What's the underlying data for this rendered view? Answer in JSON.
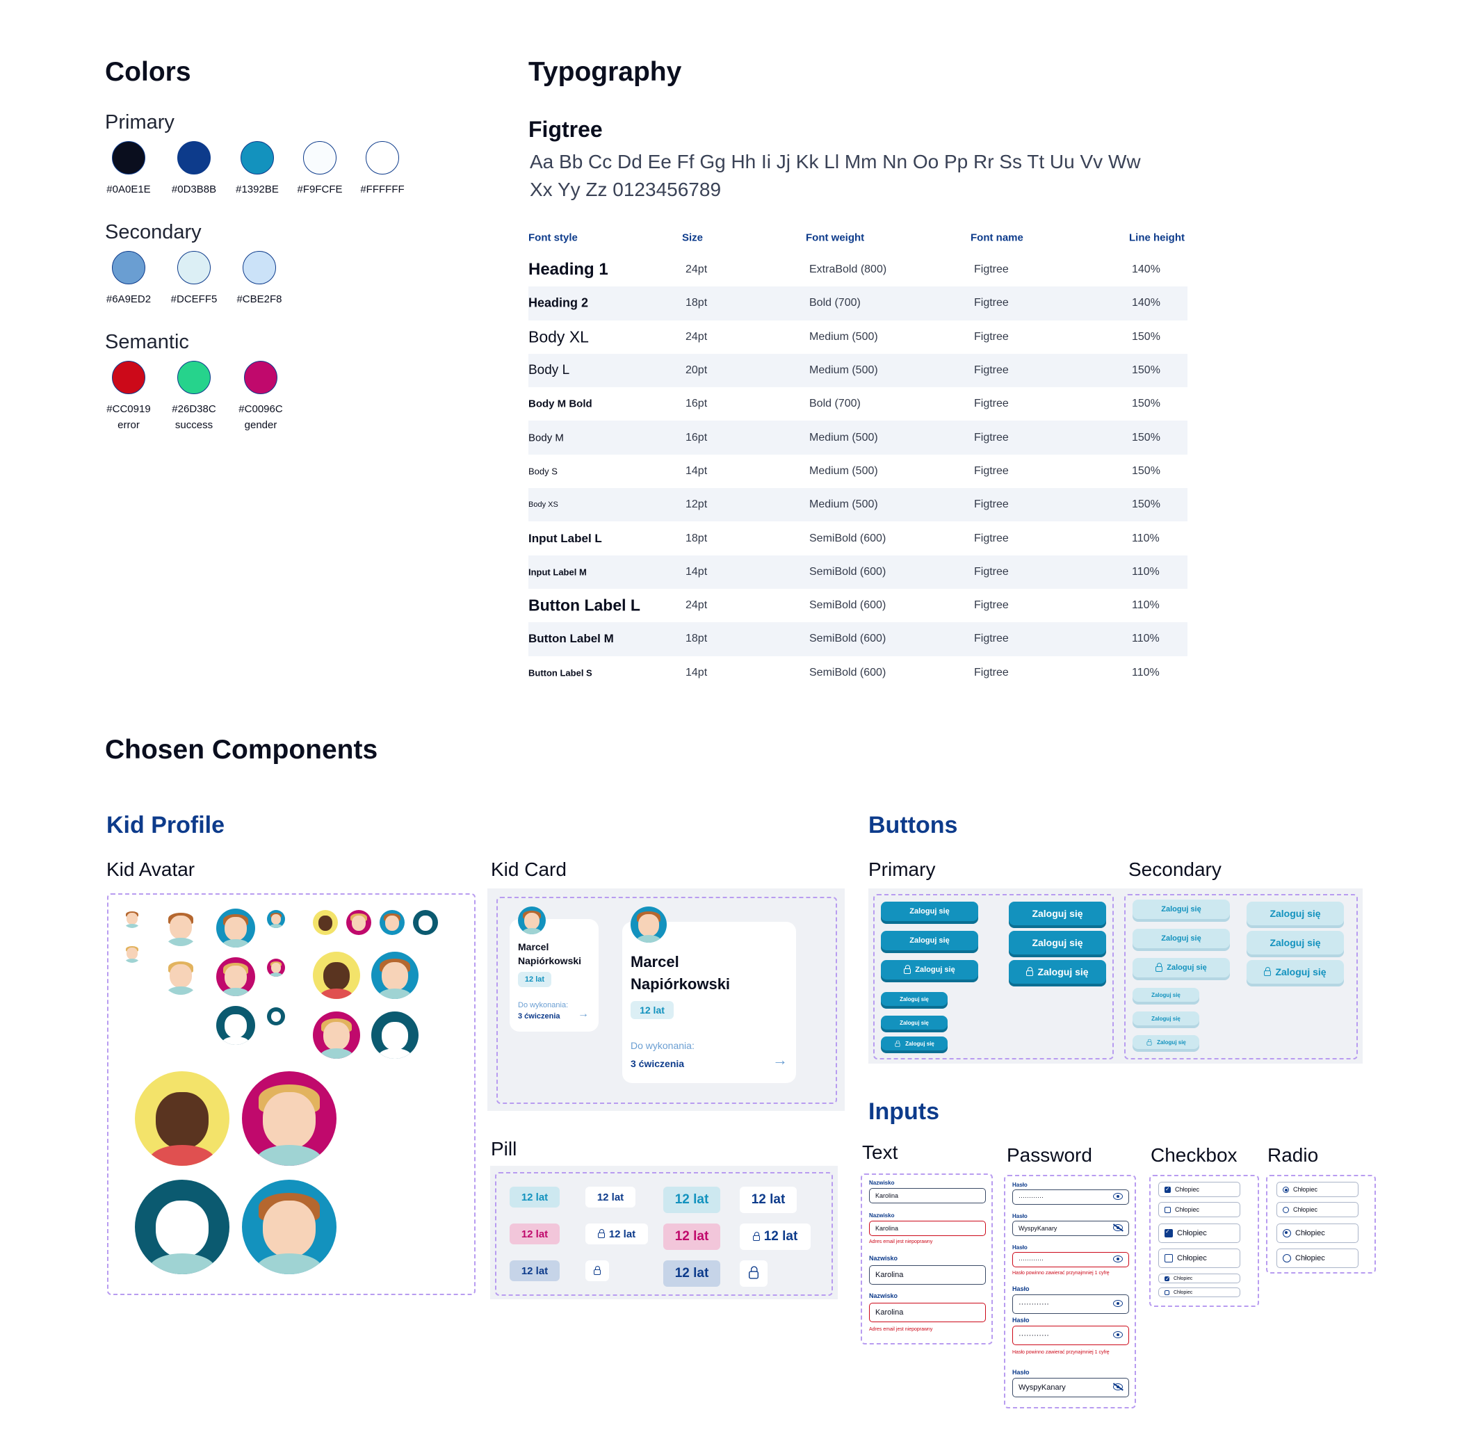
{
  "colors": {
    "title": "Colors",
    "primary_label": "Primary",
    "primary": [
      {
        "hex": "#0A0E1E"
      },
      {
        "hex": "#0D3B8B"
      },
      {
        "hex": "#1392BE"
      },
      {
        "hex": "#F9FCFE"
      },
      {
        "hex": "#FFFFFF"
      }
    ],
    "secondary_label": "Secondary",
    "secondary": [
      {
        "hex": "#6A9ED2"
      },
      {
        "hex": "#DCEFF5"
      },
      {
        "hex": "#CBE2F8"
      }
    ],
    "semantic_label": "Semantic",
    "semantic": [
      {
        "hex": "#CC0919",
        "name": "error"
      },
      {
        "hex": "#26D38C",
        "name": "success"
      },
      {
        "hex": "#C0096C",
        "name": "gender"
      }
    ]
  },
  "typography": {
    "title": "Typography",
    "font_name": "Figtree",
    "alphabet_line1": "Aa Bb Cc Dd Ee Ff Gg Hh Ii Jj Kk Ll Mm Nn Oo Pp Rr Ss Tt Uu Vv Ww",
    "alphabet_line2": "Xx Yy Zz 0123456789",
    "headers": [
      "Font style",
      "Size",
      "Font weight",
      "Font name",
      "Line height"
    ],
    "rows": [
      {
        "style": "Heading 1",
        "size": "24pt",
        "weight": "ExtraBold (800)",
        "font": "Figtree",
        "lh": "140%"
      },
      {
        "style": "Heading 2",
        "size": "18pt",
        "weight": "Bold (700)",
        "font": "Figtree",
        "lh": "140%"
      },
      {
        "style": "Body XL",
        "size": "24pt",
        "weight": "Medium (500)",
        "font": "Figtree",
        "lh": "150%"
      },
      {
        "style": "Body L",
        "size": "20pt",
        "weight": "Medium (500)",
        "font": "Figtree",
        "lh": "150%"
      },
      {
        "style": "Body M Bold",
        "size": "16pt",
        "weight": "Bold (700)",
        "font": "Figtree",
        "lh": "150%"
      },
      {
        "style": "Body M",
        "size": "16pt",
        "weight": "Medium (500)",
        "font": "Figtree",
        "lh": "150%"
      },
      {
        "style": "Body S",
        "size": "14pt",
        "weight": "Medium (500)",
        "font": "Figtree",
        "lh": "150%"
      },
      {
        "style": "Body XS",
        "size": "12pt",
        "weight": "Medium (500)",
        "font": "Figtree",
        "lh": "150%"
      },
      {
        "style": "Input Label L",
        "size": "18pt",
        "weight": "SemiBold (600)",
        "font": "Figtree",
        "lh": "110%"
      },
      {
        "style": "Input Label M",
        "size": "14pt",
        "weight": "SemiBold (600)",
        "font": "Figtree",
        "lh": "110%"
      },
      {
        "style": "Button Label L",
        "size": "24pt",
        "weight": "SemiBold (600)",
        "font": "Figtree",
        "lh": "110%"
      },
      {
        "style": "Button Label M",
        "size": "18pt",
        "weight": "SemiBold (600)",
        "font": "Figtree",
        "lh": "110%"
      },
      {
        "style": "Button Label S",
        "size": "14pt",
        "weight": "SemiBold (600)",
        "font": "Figtree",
        "lh": "110%"
      }
    ]
  },
  "components": {
    "title": "Chosen Components",
    "kid_profile": "Kid Profile",
    "kid_avatar": "Kid Avatar",
    "kid_card": "Kid Card",
    "pill": "Pill",
    "buttons": "Buttons",
    "primary": "Primary",
    "secondary": "Secondary",
    "inputs": "Inputs",
    "text": "Text",
    "password": "Password",
    "checkbox": "Checkbox",
    "radio": "Radio"
  },
  "kid_card": {
    "first": "Marcel",
    "last": "Napiórkowski",
    "age": "12 lat",
    "todo_label": "Do wykonania:",
    "todo_value": "3 ćwiczenia"
  },
  "pill_label": "12 lat",
  "button_label": "Zaloguj się",
  "inputs": {
    "lastname_label": "Nazwisko",
    "name_value": "Karolina",
    "email_error": "Adres email jest niepoprawny",
    "password_label": "Hasło",
    "password_mask": "············",
    "password_plain": "WyspyKanary",
    "password_error": "Hasło powinno zawierać przynajmniej 1 cyfrę",
    "option": "Chłopiec"
  }
}
